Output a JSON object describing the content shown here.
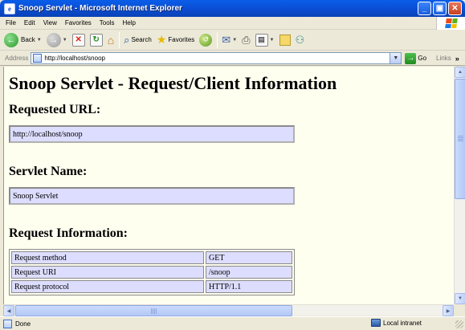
{
  "window": {
    "title": "Snoop Servlet - Microsoft Internet Explorer",
    "app_icon": "ie-page-icon"
  },
  "menubar": {
    "items": [
      "File",
      "Edit",
      "View",
      "Favorites",
      "Tools",
      "Help"
    ]
  },
  "toolbar": {
    "back_label": "Back",
    "search_label": "Search",
    "favorites_label": "Favorites"
  },
  "addressbar": {
    "label": "Address",
    "url": "http://localhost/snoop",
    "go_label": "Go",
    "links_label": "Links"
  },
  "page": {
    "heading": "Snoop Servlet - Request/Client Information",
    "requested_url_heading": "Requested URL:",
    "requested_url_value": "http://localhost/snoop",
    "servlet_name_heading": "Servlet Name:",
    "servlet_name_value": "Snoop Servlet",
    "request_info_heading": "Request Information:",
    "request_info_rows": [
      {
        "key": "Request method",
        "value": "GET"
      },
      {
        "key": "Request URI",
        "value": "/snoop"
      },
      {
        "key": "Request protocol",
        "value": "HTTP/1.1"
      }
    ]
  },
  "statusbar": {
    "status_text": "Done",
    "zone_text": "Local intranet"
  },
  "colors": {
    "titlebar": "#0b4fd6",
    "page_background": "#fffff0",
    "info_cell": "#ddddff"
  }
}
